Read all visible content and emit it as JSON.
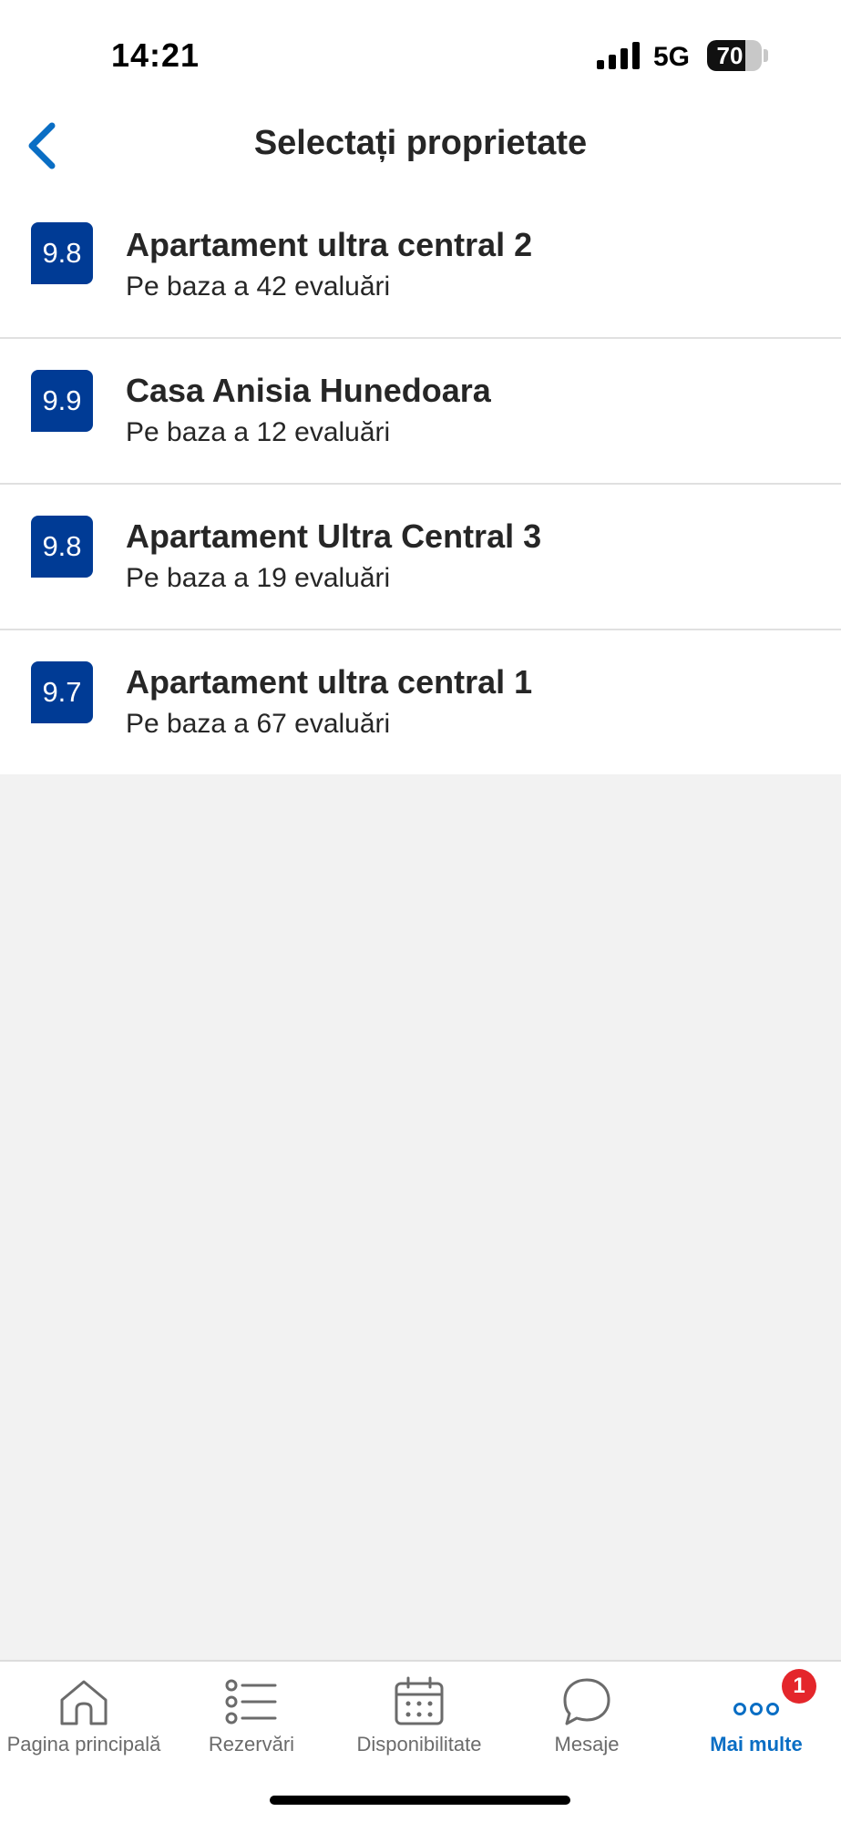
{
  "status_bar": {
    "time": "14:21",
    "network": "5G",
    "battery": "70",
    "battery_level": 0.7
  },
  "header": {
    "title": "Selectați proprietate"
  },
  "properties": [
    {
      "score": "9.8",
      "name": "Apartament ultra central 2",
      "reviews": "Pe baza a 42 evaluări"
    },
    {
      "score": "9.9",
      "name": "Casa Anisia Hunedoara",
      "reviews": "Pe baza a 12 evaluări"
    },
    {
      "score": "9.8",
      "name": "Apartament Ultra Central 3",
      "reviews": "Pe baza a 19 evaluări"
    },
    {
      "score": "9.7",
      "name": "Apartament ultra central 1",
      "reviews": "Pe baza a 67 evaluări"
    }
  ],
  "tab_bar": {
    "tabs": [
      {
        "label": "Pagina principală",
        "icon": "home-icon"
      },
      {
        "label": "Rezervări",
        "icon": "list-icon"
      },
      {
        "label": "Disponibilitate",
        "icon": "calendar-icon"
      },
      {
        "label": "Mesaje",
        "icon": "chat-bubble-icon"
      },
      {
        "label": "Mai multe",
        "icon": "more-dots-icon",
        "active": true,
        "badge": "1"
      }
    ]
  },
  "colors": {
    "accent": "#0a6ec4",
    "score_badge": "#003b95",
    "notification_badge": "#e4262b",
    "background": "#f2f2f2"
  }
}
